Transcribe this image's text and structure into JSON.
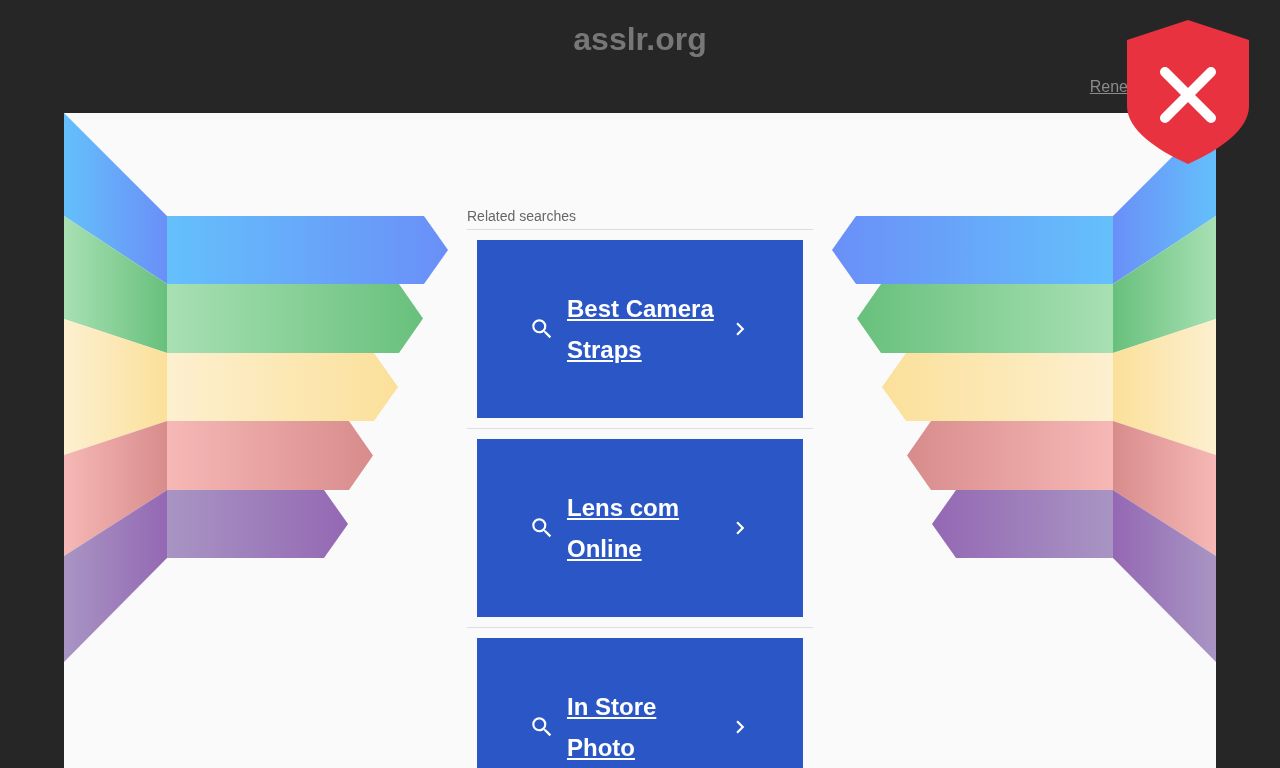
{
  "site_title": "asslr.org",
  "renew_link": "Rene",
  "related_searches": {
    "heading": "Related searches",
    "items": [
      {
        "label": "Best Camera Straps"
      },
      {
        "label": "Lens com Online"
      },
      {
        "label": "In Store Photo"
      }
    ]
  }
}
